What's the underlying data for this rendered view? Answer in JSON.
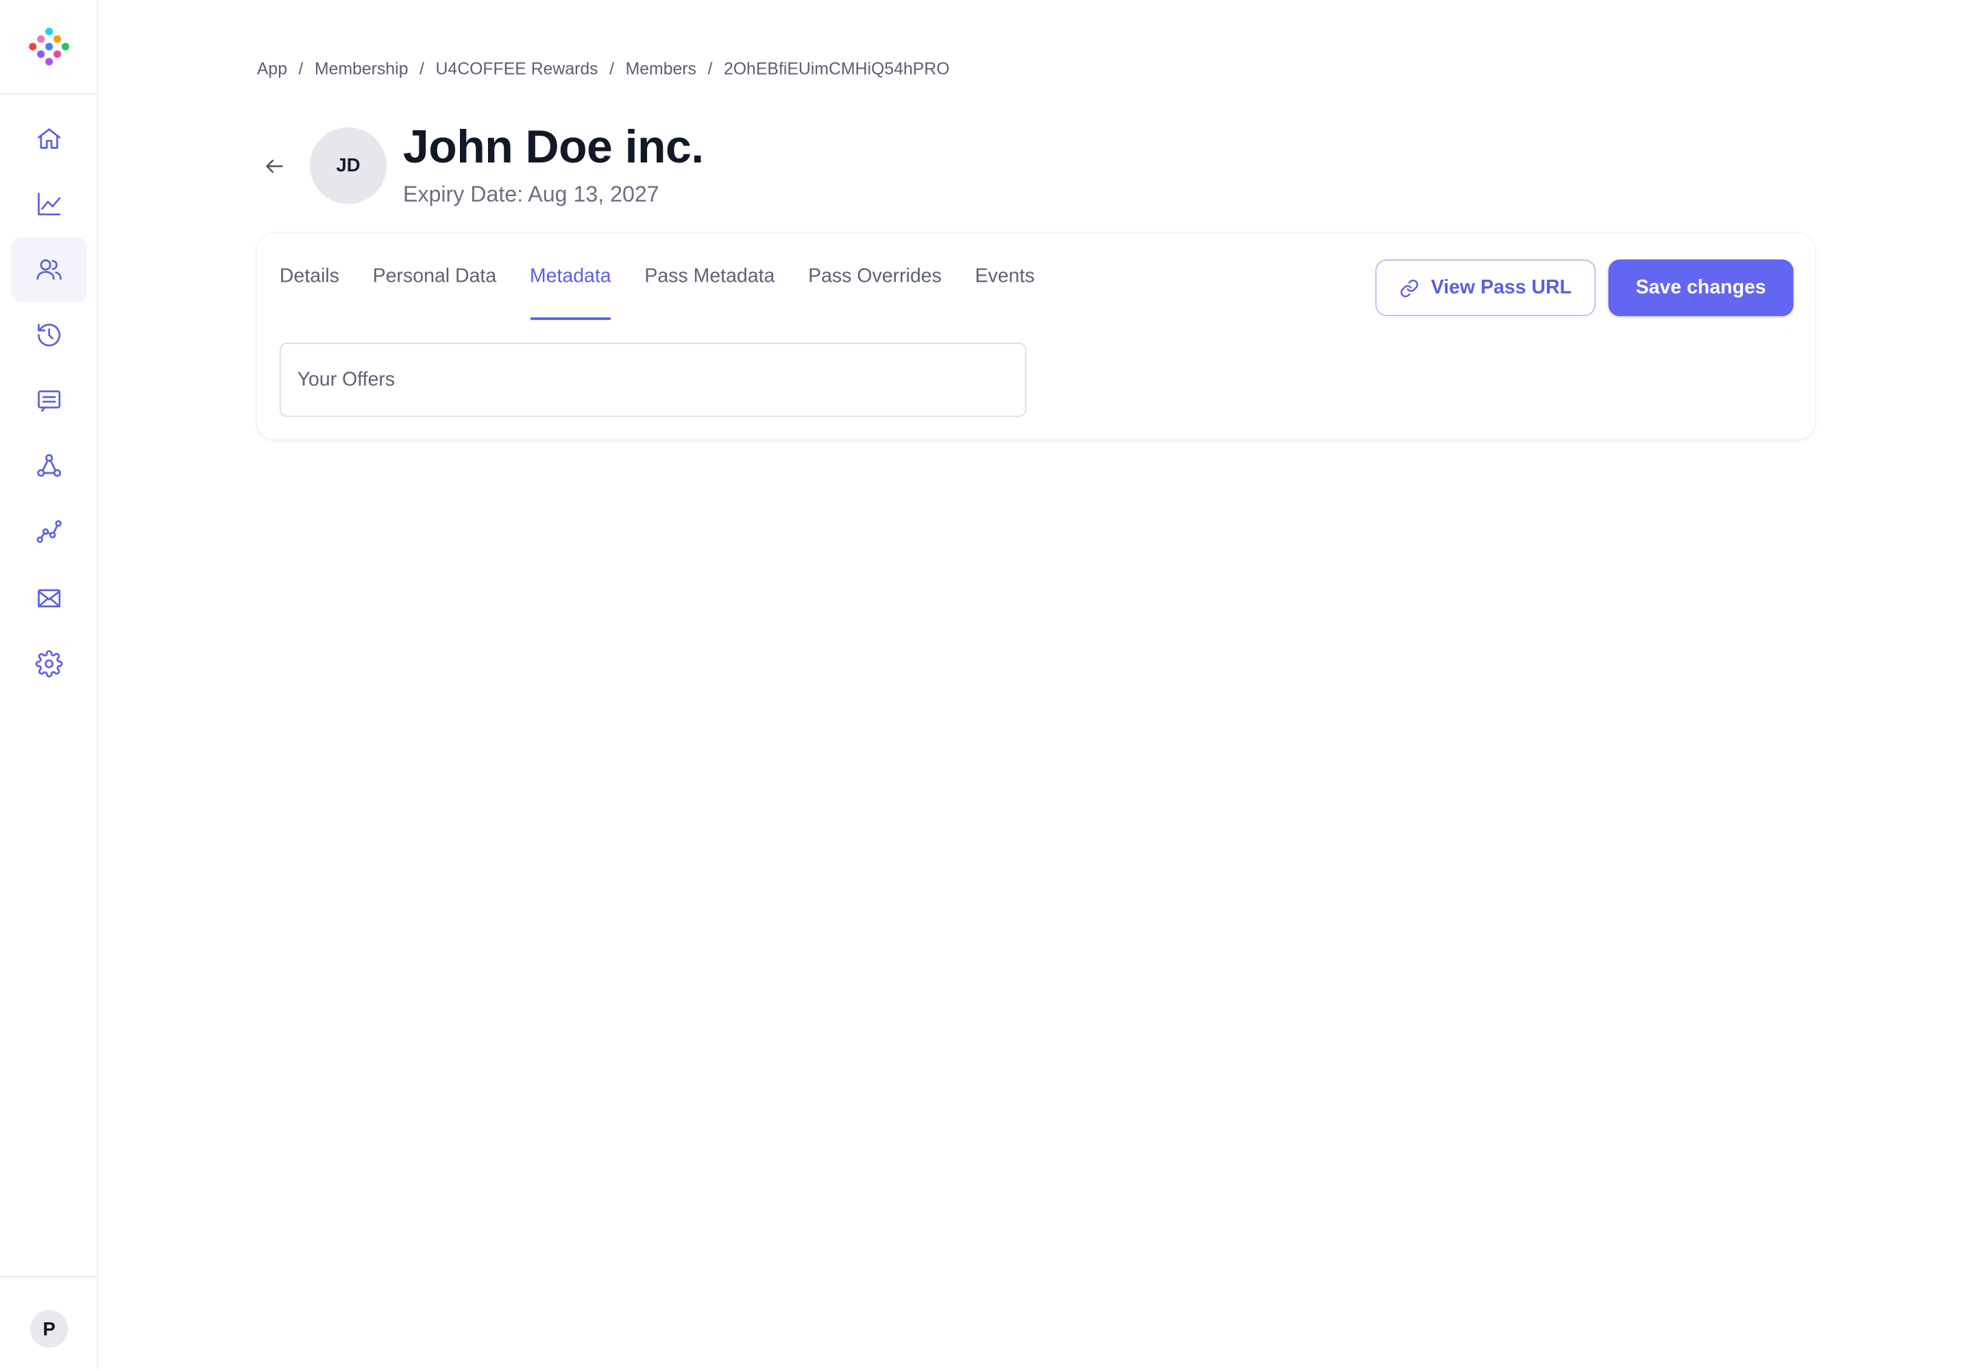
{
  "colors": {
    "accent": "#6366f1",
    "accent_text": "#5b5fe0",
    "active_nav_bg": "#f3f4fb",
    "icon_stroke": "#5b5fe0",
    "title_text": "#111827",
    "muted_text": "#6b7080"
  },
  "sidebar": {
    "logo_icon": "colorful-dots-logo-icon",
    "items": [
      {
        "icon": "home-icon",
        "active": false
      },
      {
        "icon": "line-chart-icon",
        "active": false
      },
      {
        "icon": "users-icon",
        "active": true
      },
      {
        "icon": "history-icon",
        "active": false
      },
      {
        "icon": "message-icon",
        "active": false
      },
      {
        "icon": "webhook-icon",
        "active": false
      },
      {
        "icon": "analytics-icon",
        "active": false
      },
      {
        "icon": "mail-icon",
        "active": false
      },
      {
        "icon": "gear-icon",
        "active": false
      }
    ],
    "user_initial": "P"
  },
  "breadcrumb": {
    "items": [
      "App",
      "Membership",
      "U4COFFEE Rewards",
      "Members",
      "2OhEBfiEUimCMHiQ54hPRO"
    ],
    "separator": "/"
  },
  "member": {
    "initials": "JD",
    "name": "John Doe inc.",
    "expiry": "Expiry Date: Aug 13, 2027"
  },
  "tabs": {
    "items": [
      "Details",
      "Personal Data",
      "Metadata",
      "Pass Metadata",
      "Pass Overrides",
      "Events"
    ],
    "active": "Metadata"
  },
  "actions": {
    "view_pass_url": "View Pass URL",
    "save_changes": "Save changes"
  },
  "metadata_field": {
    "label": "Your Offers"
  }
}
